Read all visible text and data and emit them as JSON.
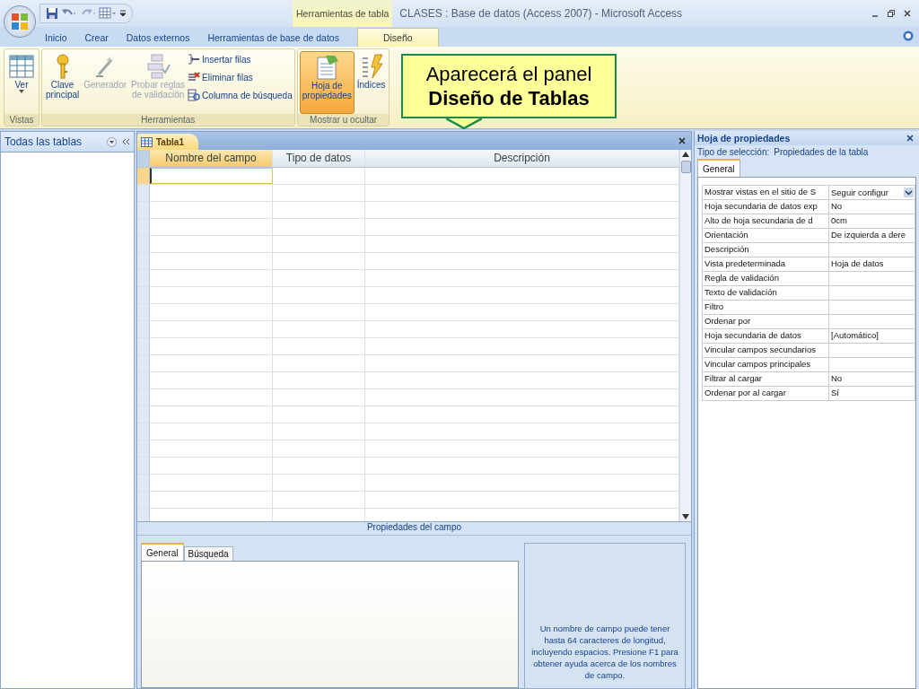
{
  "window": {
    "title": "CLASES : Base de datos (Access 2007) - Microsoft Access",
    "contextual_group": "Herramientas de tabla"
  },
  "ribbon_tabs": [
    {
      "label": "Inicio",
      "selected": false
    },
    {
      "label": "Crear",
      "selected": false
    },
    {
      "label": "Datos externos",
      "selected": false
    },
    {
      "label": "Herramientas de base de datos",
      "selected": false
    },
    {
      "label": "Diseño",
      "selected": true
    }
  ],
  "ribbon_groups": [
    {
      "label": "Vistas",
      "buttons": [
        {
          "kind": "large",
          "label": "Ver",
          "disabled": false,
          "selected": false
        }
      ]
    },
    {
      "label": "Herramientas",
      "buttons": [
        {
          "kind": "large",
          "label": "Clave\nprincipal",
          "disabled": false,
          "selected": false
        },
        {
          "kind": "large",
          "label": "Generador",
          "disabled": true,
          "selected": false
        },
        {
          "kind": "large",
          "label": "Probar reglas\nde validación",
          "disabled": true,
          "selected": false
        },
        {
          "kind": "small",
          "label": "Insertar filas",
          "disabled": false
        },
        {
          "kind": "small",
          "label": "Eliminar filas",
          "disabled": false
        },
        {
          "kind": "small",
          "label": "Columna de búsqueda",
          "disabled": false
        }
      ]
    },
    {
      "label": "Mostrar u ocultar",
      "buttons": [
        {
          "kind": "large",
          "label": "Hoja de\npropiedades",
          "disabled": false,
          "selected": true
        },
        {
          "kind": "large",
          "label": "Índices",
          "disabled": false,
          "selected": false
        }
      ]
    }
  ],
  "callout": {
    "text": "Aparecerá el panel\n**Diseño de Tablas**"
  },
  "nav_pane": {
    "title": "Todas las tablas"
  },
  "document": {
    "tab": "Tabla1",
    "columns": [
      "Nombre del campo",
      "Tipo de datos",
      "Descripción"
    ],
    "rows": [
      {
        "selected": true
      },
      {
        "selected": false
      },
      {
        "selected": false
      },
      {
        "selected": false
      },
      {
        "selected": false
      },
      {
        "selected": false
      },
      {
        "selected": false
      },
      {
        "selected": false
      },
      {
        "selected": false
      },
      {
        "selected": false
      },
      {
        "selected": false
      },
      {
        "selected": false
      },
      {
        "selected": false
      },
      {
        "selected": false
      },
      {
        "selected": false
      },
      {
        "selected": false
      },
      {
        "selected": false
      },
      {
        "selected": false
      },
      {
        "selected": false
      },
      {
        "selected": false
      },
      {
        "selected": false
      }
    ]
  },
  "field_properties": {
    "title": "Propiedades del campo",
    "tabs": [
      {
        "label": "General",
        "selected": true
      },
      {
        "label": "Búsqueda",
        "selected": false
      }
    ],
    "help_text": "Un nombre de campo puede tener hasta 64 caracteres de longitud, incluyendo espacios. Presione F1 para obtener ayuda acerca de los nombres de campo."
  },
  "property_sheet": {
    "title": "Hoja de propiedades",
    "selection_label": "Tipo de selección:",
    "selection_value": "Propiedades de la tabla",
    "tabs": [
      {
        "label": "General",
        "selected": true
      }
    ],
    "properties": [
      {
        "name": "Mostrar vistas en el sitio de S",
        "value": "Seguir configur",
        "kind": "dropdown"
      },
      {
        "name": "Hoja secundaria de datos exp",
        "value": "No",
        "kind": "text"
      },
      {
        "name": "Alto de hoja secundaria de d",
        "value": "0cm",
        "kind": "text"
      },
      {
        "name": "Orientación",
        "value": "De izquierda a dere",
        "kind": "text"
      },
      {
        "name": "Descripción",
        "kind": "text"
      },
      {
        "name": "Vista predeterminada",
        "value": "Hoja de datos",
        "kind": "text"
      },
      {
        "name": "Regla de validación",
        "kind": "text"
      },
      {
        "name": "Texto de validación",
        "kind": "text"
      },
      {
        "name": "Filtro",
        "kind": "text"
      },
      {
        "name": "Ordenar por",
        "kind": "text"
      },
      {
        "name": "Hoja secundaria de datos",
        "value": "[Automático]",
        "kind": "text"
      },
      {
        "name": "Vincular campos secundarios",
        "kind": "text"
      },
      {
        "name": "Vincular campos principales",
        "kind": "text"
      },
      {
        "name": "Filtrar al cargar",
        "value": "No",
        "kind": "text"
      },
      {
        "name": "Ordenar por al cargar",
        "value": "Sí",
        "kind": "text"
      }
    ]
  }
}
